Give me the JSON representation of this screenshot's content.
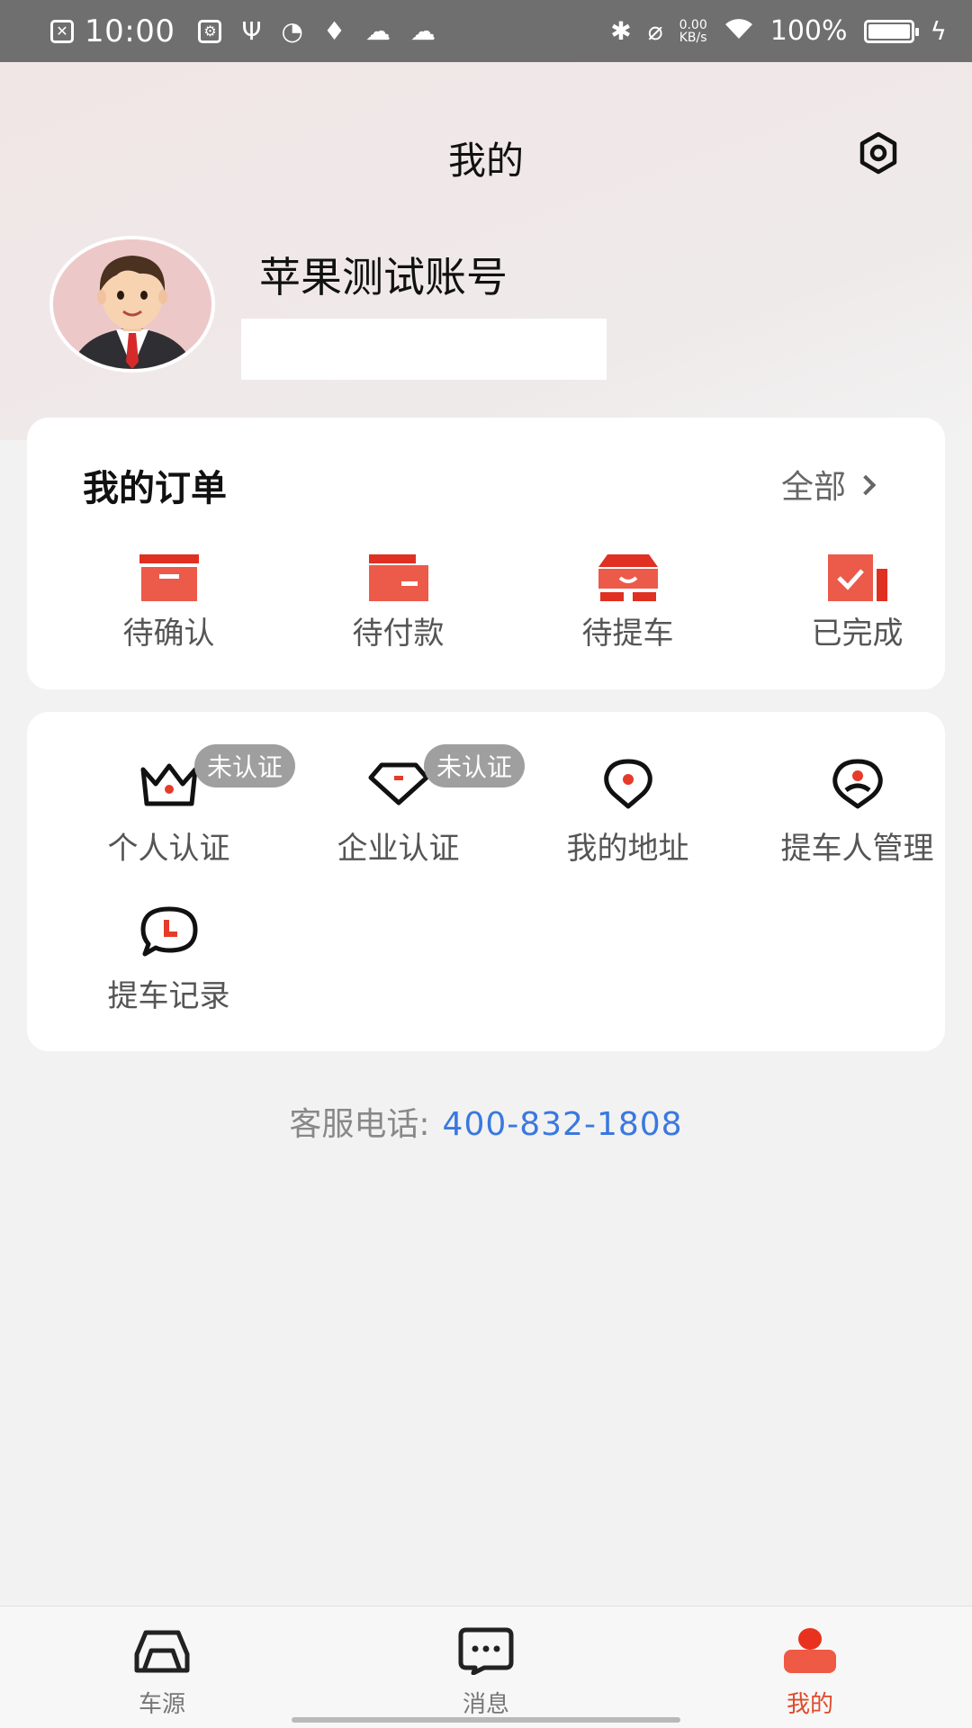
{
  "status_bar": {
    "time": "10:00",
    "net_speed_value": "0.00",
    "net_speed_unit": "KB/s",
    "battery": "100%"
  },
  "header": {
    "title": "我的",
    "username": "苹果测试账号"
  },
  "orders": {
    "title": "我的订单",
    "view_all": "全部",
    "items": [
      {
        "label": "待确认",
        "icon": "inbox-icon"
      },
      {
        "label": "待付款",
        "icon": "wallet-icon"
      },
      {
        "label": "待提车",
        "icon": "car-pickup-icon"
      },
      {
        "label": "已完成",
        "icon": "check-done-icon"
      }
    ]
  },
  "services": {
    "items": [
      {
        "label": "个人认证",
        "badge": "未认证",
        "icon": "crown-icon"
      },
      {
        "label": "企业认证",
        "badge": "未认证",
        "icon": "diamond-icon"
      },
      {
        "label": "我的地址",
        "icon": "location-icon"
      },
      {
        "label": "提车人管理",
        "icon": "person-manage-icon"
      },
      {
        "label": "提车记录",
        "icon": "chat-clock-icon"
      }
    ]
  },
  "hotline": {
    "label": "客服电话:",
    "number": "400-832-1808"
  },
  "tabbar": {
    "items": [
      {
        "label": "车源",
        "active": false
      },
      {
        "label": "消息",
        "active": false
      },
      {
        "label": "我的",
        "active": true
      }
    ]
  },
  "colors": {
    "accent": "#e63b2a",
    "link": "#3a78e0",
    "badge": "#9f9f9f"
  }
}
